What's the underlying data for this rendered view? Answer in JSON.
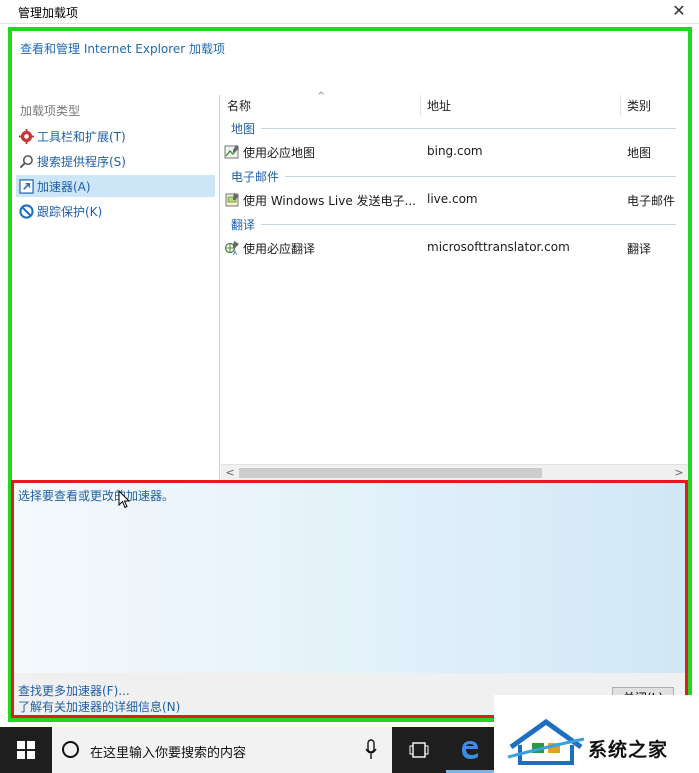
{
  "window": {
    "title": "管理加载项",
    "close_glyph": "✕"
  },
  "heading": "查看和管理 Internet Explorer 加载项",
  "left_pane": {
    "group_label": "加载项类型",
    "items": [
      {
        "label": "工具栏和扩展(T)",
        "icon": "gear-icon",
        "selected": false
      },
      {
        "label": "搜索提供程序(S)",
        "icon": "search-icon",
        "selected": false
      },
      {
        "label": "加速器(A)",
        "icon": "accelerator-icon",
        "selected": true
      },
      {
        "label": "跟踪保护(K)",
        "icon": "no-entry-icon",
        "selected": false
      }
    ]
  },
  "list": {
    "columns": [
      "名称",
      "地址",
      "类别"
    ],
    "sort_glyph": "^",
    "groups": [
      {
        "name": "地图",
        "rows": [
          {
            "name": "使用必应地图",
            "address": "bing.com",
            "category": "地图",
            "icon": "map-icon"
          }
        ]
      },
      {
        "name": "电子邮件",
        "rows": [
          {
            "name": "使用 Windows Live 发送电子...",
            "address": "live.com",
            "category": "电子邮件",
            "icon": "mail-icon"
          }
        ]
      },
      {
        "name": "翻译",
        "rows": [
          {
            "name": "使用必应翻译",
            "address": "microsofttranslator.com",
            "category": "翻译",
            "icon": "translate-icon"
          }
        ]
      }
    ],
    "scroll_left": "<",
    "scroll_right": ">"
  },
  "detail": {
    "prompt": "选择要查看或更改的加速器。"
  },
  "footer": {
    "link_find": "查找更多加速器(F)...",
    "link_learn": "了解有关加速器的详细信息(N)",
    "close_button": "关闭(L)"
  },
  "taskbar": {
    "search_placeholder": "在这里输入你要搜索的内容"
  },
  "watermark": {
    "text": "系统之家"
  },
  "colors": {
    "link": "#1e5fa8",
    "selection": "#cde6f7",
    "highlight_green": "#22d622",
    "highlight_red": "#e01c1c"
  }
}
